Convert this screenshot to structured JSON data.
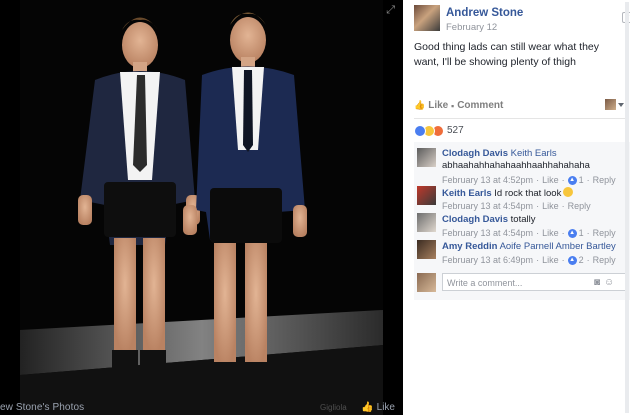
{
  "viewer": {
    "caption": "ew Stone's Photos",
    "like_label": "Like",
    "watermark": "Gigliola"
  },
  "post": {
    "author": "Andrew Stone",
    "date": "February 12",
    "text": "Good thing lads can still wear what they want, I'll be showing plenty of thigh",
    "actions": {
      "like": "Like",
      "comment": "Comment"
    },
    "reaction_count": "527"
  },
  "comments": [
    {
      "name": "Clodagh Davis",
      "tag": "Keith Earls",
      "text": "abhaahahhahahaahhaahhahahaha",
      "time": "February 13 at 4:52pm",
      "like": "Like",
      "likes": "1",
      "reply": "Reply"
    },
    {
      "name": "Keith Earls",
      "tag": "",
      "text": "Id rock that look",
      "time": "February 13 at 4:54pm",
      "like": "Like",
      "likes": "",
      "reply": "Reply"
    },
    {
      "name": "Clodagh Davis",
      "tag": "",
      "text": "totally",
      "time": "February 13 at 4:54pm",
      "like": "Like",
      "likes": "1",
      "reply": "Reply"
    },
    {
      "name": "Amy Reddin",
      "tag": "Aoife Parnell Amber Bartley",
      "text": "",
      "time": "February 13 at 6:49pm",
      "like": "Like",
      "likes": "2",
      "reply": "Reply"
    }
  ],
  "composer": {
    "placeholder": "Write a comment..."
  }
}
